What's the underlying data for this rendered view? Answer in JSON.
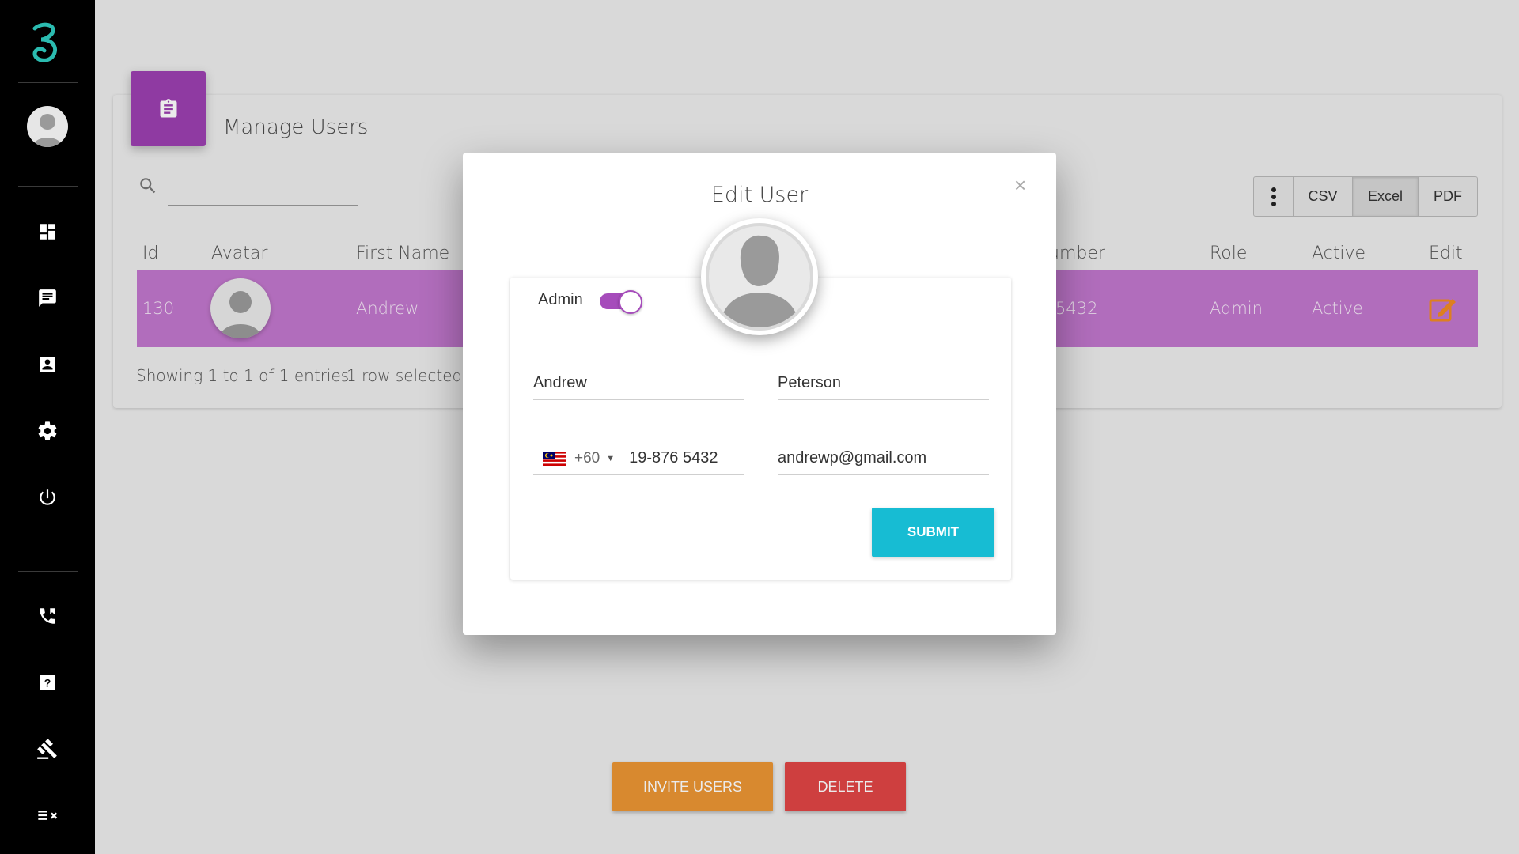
{
  "sidebar": {
    "items": [
      {
        "icon": "dashboard-icon"
      },
      {
        "icon": "chat-icon"
      },
      {
        "icon": "contact-card-icon"
      },
      {
        "icon": "gear-icon"
      },
      {
        "icon": "power-icon"
      },
      {
        "icon": "phone-icon"
      },
      {
        "icon": "help-icon"
      },
      {
        "icon": "gavel-icon"
      },
      {
        "icon": "checklist-icon"
      }
    ],
    "accent": "#2bbbb0"
  },
  "page": {
    "title": "Manage Users",
    "accent": "#9c3fb0"
  },
  "search": {
    "value": ""
  },
  "export": {
    "csv": "CSV",
    "excel": "Excel",
    "pdf": "PDF"
  },
  "table": {
    "headers": [
      "Id",
      "Avatar",
      "First Name",
      "umber",
      "Role",
      "Active",
      "Edit"
    ],
    "row": {
      "id": "130",
      "first_name": "Andrew",
      "number": "5432",
      "role": "Admin",
      "active": "Active"
    },
    "row_color": "#c177cc",
    "info": "Showing 1 to 1 of 1 entries",
    "selected": "1 row selected"
  },
  "actions": {
    "invite": "INVITE USERS",
    "delete": "DELETE",
    "invite_color": "#eb9534",
    "delete_color": "#e04545"
  },
  "modal": {
    "title": "Edit User",
    "close": "×",
    "admin_label": "Admin",
    "admin_on": true,
    "first_name": "Andrew",
    "last_name": "Peterson",
    "dial_code": "+60",
    "phone": "19-876 5432",
    "email": "andrewp@gmail.com",
    "submit": "SUBMIT",
    "submit_color": "#17bcd3"
  }
}
